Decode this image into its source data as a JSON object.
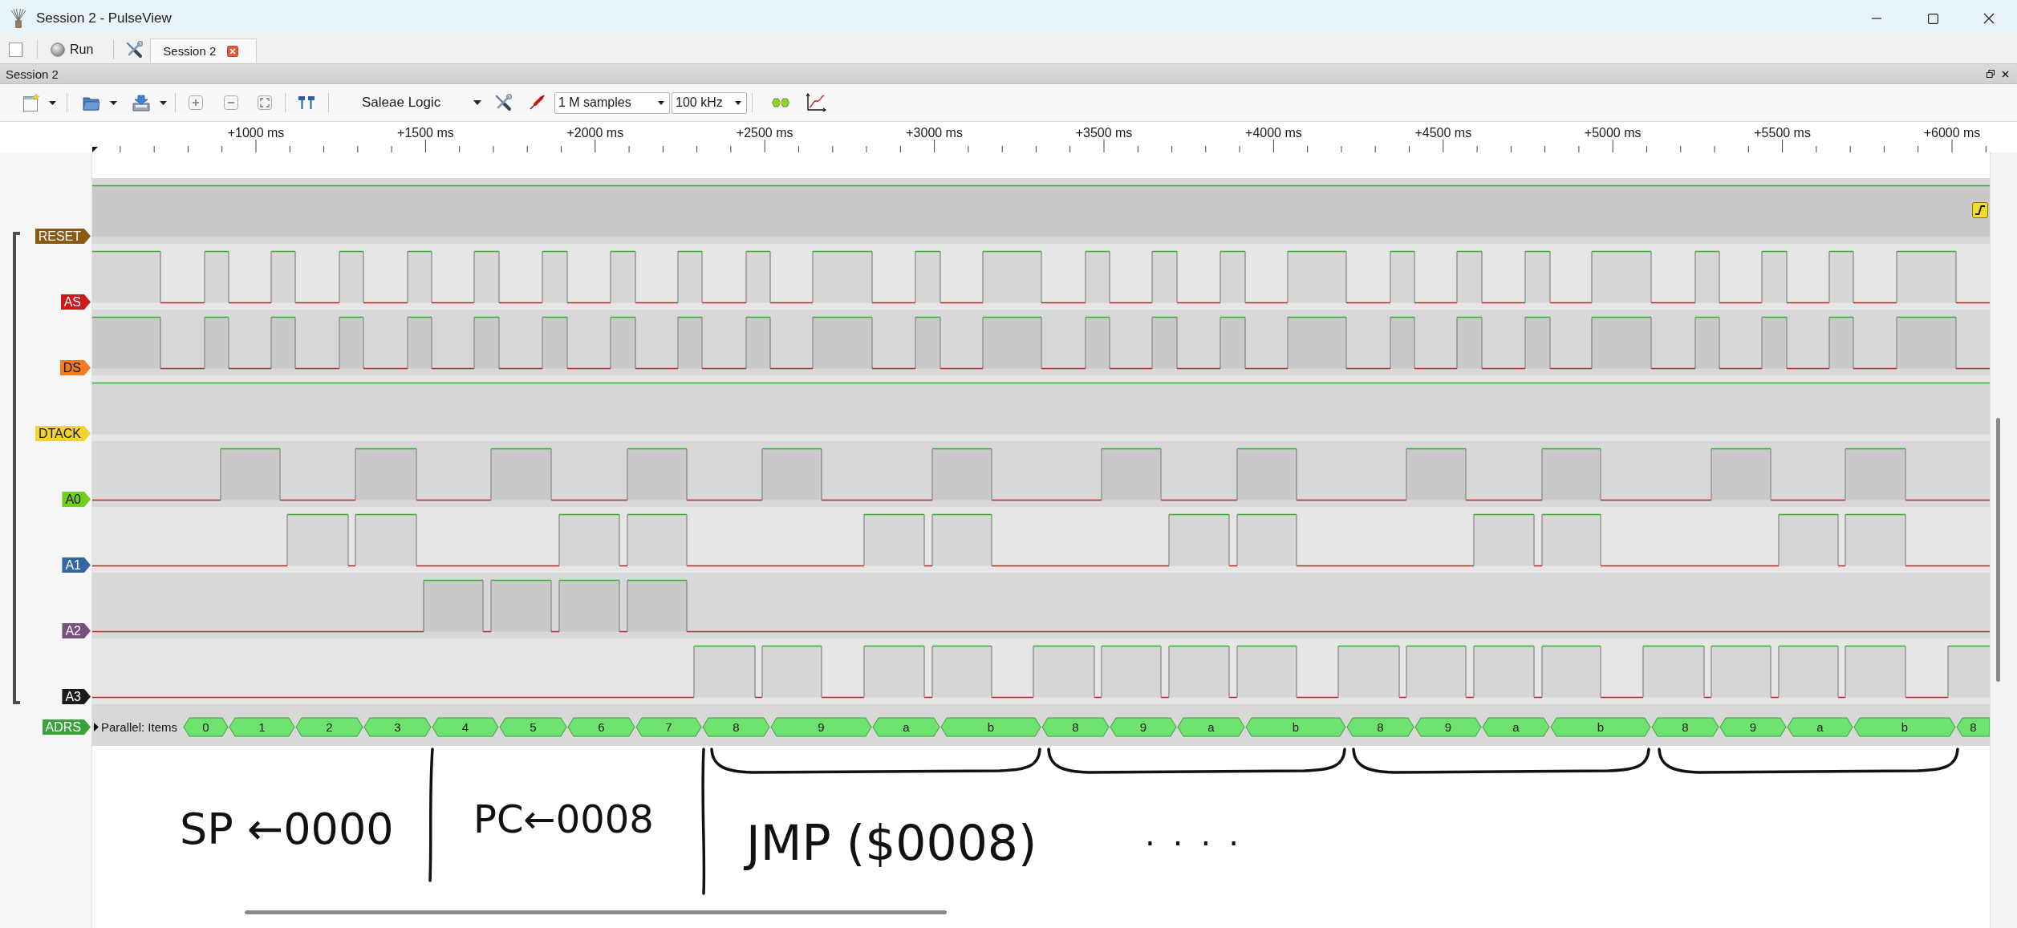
{
  "window": {
    "title": "Session 2 - PulseView"
  },
  "main_bar": {
    "run_button": {
      "label": "Run"
    },
    "tabs": [
      {
        "label": "Session 2",
        "selected": true
      }
    ]
  },
  "session_dock": {
    "title": "Session 2"
  },
  "toolbar": {
    "device": "Saleae Logic",
    "sample_count": "1 M samples",
    "sample_rate": "100 kHz"
  },
  "ruler": {
    "labels": [
      "+1000 ms",
      "+1500 ms",
      "+2000 ms",
      "+2500 ms",
      "+3000 ms",
      "+3500 ms",
      "+4000 ms",
      "+4500 ms",
      "+5000 ms",
      "+5500 ms",
      "+6000 ms"
    ]
  },
  "signal_group": {
    "signals": [
      {
        "name": "RESET",
        "color": "#8a5a14",
        "trigger": true
      },
      {
        "name": "AS",
        "color": "#cc1a1a",
        "trigger": false
      },
      {
        "name": "DS",
        "color": "#f47b20",
        "trigger": false
      },
      {
        "name": "DTACK",
        "color": "#f2d42c",
        "trigger": false
      },
      {
        "name": "A0",
        "color": "#6fd11d",
        "trigger": false
      },
      {
        "name": "A1",
        "color": "#3565a5",
        "trigger": false
      },
      {
        "name": "A2",
        "color": "#764f7c",
        "trigger": false
      },
      {
        "name": "A3",
        "color": "#1a1a1a",
        "trigger": false
      }
    ]
  },
  "decoder": {
    "name": "ADRS",
    "color": "#3aa23a",
    "row_title": "Parallel: Items",
    "annotations": [
      "0",
      "1",
      "2",
      "3",
      "4",
      "5",
      "6",
      "7",
      "8",
      "9",
      "a",
      "b",
      "8",
      "9",
      "a",
      "b",
      "8",
      "9",
      "a",
      "b",
      "8",
      "9",
      "a",
      "b",
      "8"
    ]
  },
  "notes": [
    "SP ←0000",
    "PC←0008",
    "JMP ($0008)",
    "...."
  ]
}
